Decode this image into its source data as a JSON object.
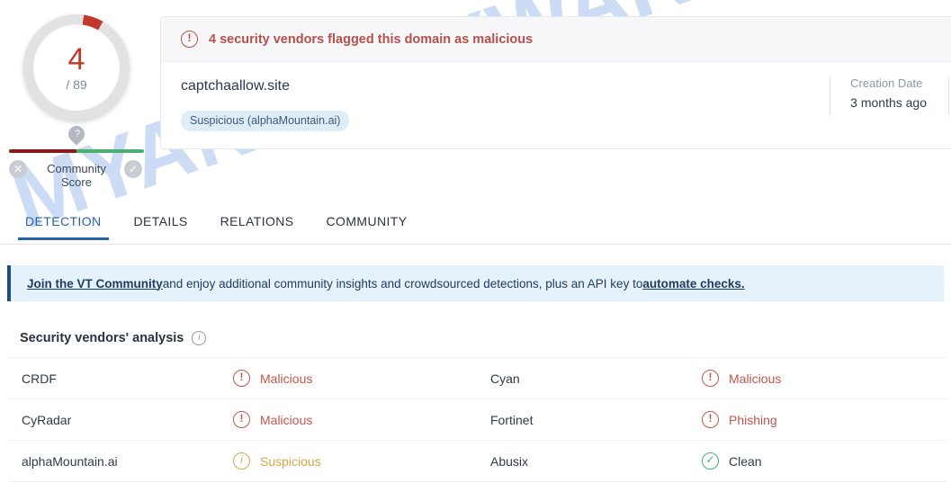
{
  "watermark": {
    "text": "MYANTISPYWARE.COM"
  },
  "score": {
    "value": "4",
    "total": "/ 89",
    "accent_color": "#c0392b"
  },
  "community_score": {
    "label": "Community Score",
    "pin_icon": "question-mark-pin-icon",
    "negative_icon": "x-circle-icon",
    "negative_glyph": "✕",
    "positive_icon": "check-circle-icon",
    "positive_glyph": "✓"
  },
  "card": {
    "alert": {
      "icon": "alert-circle-icon",
      "glyph": "!",
      "text": "4 security vendors flagged this domain as malicious",
      "color": "#b5504a"
    },
    "domain": "captchaallow.site",
    "tag": "Suspicious (alphaMountain.ai)",
    "meta": {
      "label": "Creation Date",
      "value": "3 months ago"
    }
  },
  "tabs": [
    {
      "label": "DETECTION",
      "active": true
    },
    {
      "label": "DETAILS",
      "active": false
    },
    {
      "label": "RELATIONS",
      "active": false
    },
    {
      "label": "COMMUNITY",
      "active": false
    }
  ],
  "banner": {
    "link1": "Join the VT Community",
    "middle": " and enjoy additional community insights and crowdsourced detections, plus an API key to ",
    "link2": "automate checks.",
    "accent_color": "#1d4f80",
    "background": "#e5f1fb"
  },
  "vendors_section": {
    "title": "Security vendors' analysis",
    "info_icon": "info-circle-icon",
    "info_glyph": "i",
    "rows": [
      {
        "left": {
          "name": "CRDF",
          "verdict": "Malicious",
          "state": "malicious",
          "icon": "alert-circle-icon",
          "glyph": "!"
        },
        "right": {
          "name": "Cyan",
          "verdict": "Malicious",
          "state": "malicious",
          "icon": "alert-circle-icon",
          "glyph": "!"
        }
      },
      {
        "left": {
          "name": "CyRadar",
          "verdict": "Malicious",
          "state": "malicious",
          "icon": "alert-circle-icon",
          "glyph": "!"
        },
        "right": {
          "name": "Fortinet",
          "verdict": "Phishing",
          "state": "phishing",
          "icon": "alert-circle-icon",
          "glyph": "!"
        }
      },
      {
        "left": {
          "name": "alphaMountain.ai",
          "verdict": "Suspicious",
          "state": "suspicious",
          "icon": "info-circle-icon",
          "glyph": "i"
        },
        "right": {
          "name": "Abusix",
          "verdict": "Clean",
          "state": "clean",
          "icon": "check-circle-icon",
          "glyph": "✓"
        }
      }
    ]
  }
}
